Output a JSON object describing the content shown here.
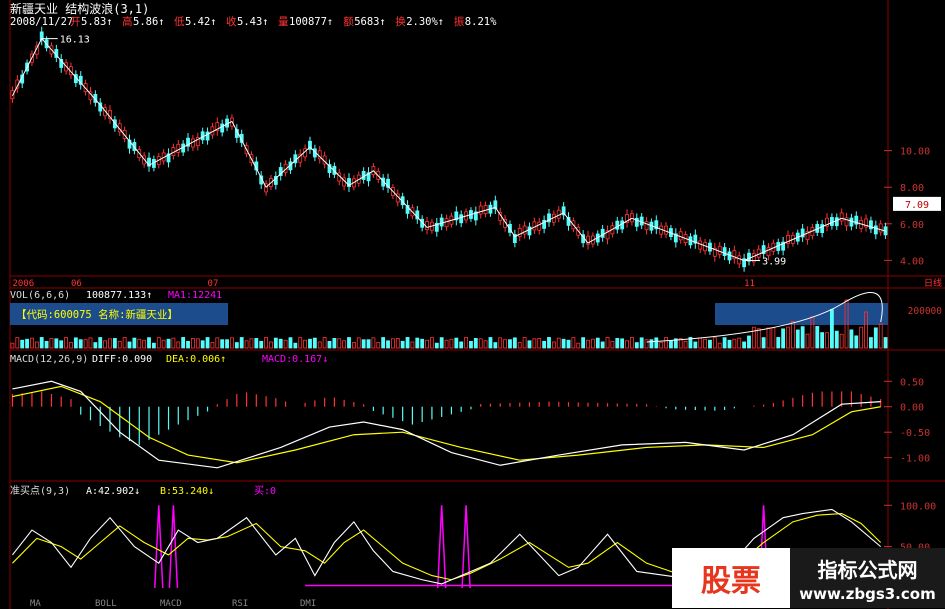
{
  "colors": {
    "up": "#ff3333",
    "down": "#54fcfc",
    "white": "#ffffff",
    "yellow": "#ffff00",
    "magenta": "#ff00ff",
    "grid": "#8b0000",
    "panel_label": "#dcdcdc",
    "axis": "#cc3333"
  },
  "header": {
    "title": "新疆天业  结构波浪(3,1)",
    "date": "2008/11/27",
    "items": [
      {
        "label": "开",
        "value": "5.83",
        "arrow": "↑"
      },
      {
        "label": "高",
        "value": "5.86",
        "arrow": "↑"
      },
      {
        "label": "低",
        "value": "5.42",
        "arrow": "↑"
      },
      {
        "label": "收",
        "value": "5.43",
        "arrow": "↑"
      },
      {
        "label": "量",
        "value": "100877",
        "arrow": "↑"
      },
      {
        "label": "额",
        "value": "5683",
        "arrow": "↑"
      },
      {
        "label": "换",
        "value": "2.30%",
        "arrow": "↑"
      },
      {
        "label": "振",
        "value": "8.21%",
        "arrow": ""
      }
    ]
  },
  "chart_data": [
    {
      "type": "candlestick",
      "panel": "price",
      "y_ticks": [
        "10.00",
        "8.00",
        "6.00",
        "4.00"
      ],
      "ylim": [
        3.2,
        16.6
      ],
      "current_price": "7.09",
      "annotations": [
        {
          "text": "16.13",
          "bar": 6,
          "value": 16.13
        },
        {
          "text": "3.99",
          "bar": 150,
          "value": 3.99
        }
      ],
      "x_labels": [
        {
          "text": "2006",
          "bar": 0
        },
        {
          "text": "06",
          "bar": 12
        },
        {
          "text": "07",
          "bar": 40
        },
        {
          "text": "11",
          "bar": 150
        }
      ],
      "period_label": "日线",
      "bar_count": 180,
      "wave": [
        [
          0,
          13.0
        ],
        [
          6,
          16.13
        ],
        [
          18,
          12.5
        ],
        [
          28,
          9.2
        ],
        [
          45,
          11.6
        ],
        [
          52,
          8.0
        ],
        [
          61,
          10.2
        ],
        [
          69,
          8.1
        ],
        [
          74,
          8.9
        ],
        [
          85,
          5.8
        ],
        [
          99,
          6.9
        ],
        [
          103,
          5.3
        ],
        [
          113,
          6.6
        ],
        [
          118,
          4.95
        ],
        [
          127,
          6.3
        ],
        [
          150,
          3.99
        ],
        [
          170,
          6.3
        ],
        [
          180,
          5.6
        ]
      ]
    },
    {
      "type": "bar",
      "panel": "volume",
      "label": "VOL(6,6,6)",
      "value_text": "100877.133",
      "ma_label": "MA1:12241",
      "info_box": "【代码:600075  名称:新疆天业】",
      "y_ticks": [
        "200000"
      ],
      "spikes": [
        [
          160,
          0.55
        ],
        [
          164,
          0.65
        ],
        [
          168,
          0.8
        ],
        [
          171,
          1.0
        ],
        [
          175,
          0.75
        ],
        [
          178,
          0.5
        ]
      ]
    },
    {
      "type": "line",
      "panel": "macd",
      "label": "MACD(12,26,9)",
      "diff": "DIFF:0.090",
      "dea": "DEA:0.006",
      "macd": "MACD:0.167",
      "y_ticks": [
        "0.50",
        "0.00",
        "-0.50",
        "-1.00"
      ],
      "ylim": [
        -1.4,
        0.8
      ],
      "diff_points": [
        [
          0,
          0.35
        ],
        [
          8,
          0.5
        ],
        [
          14,
          0.3
        ],
        [
          22,
          -0.5
        ],
        [
          30,
          -1.05
        ],
        [
          42,
          -1.2
        ],
        [
          55,
          -0.8
        ],
        [
          65,
          -0.4
        ],
        [
          72,
          -0.3
        ],
        [
          80,
          -0.45
        ],
        [
          90,
          -0.9
        ],
        [
          100,
          -1.15
        ],
        [
          112,
          -0.95
        ],
        [
          125,
          -0.75
        ],
        [
          138,
          -0.7
        ],
        [
          150,
          -0.85
        ],
        [
          160,
          -0.55
        ],
        [
          170,
          0.05
        ],
        [
          178,
          0.1
        ]
      ],
      "dea_points": [
        [
          0,
          0.2
        ],
        [
          10,
          0.4
        ],
        [
          18,
          0.1
        ],
        [
          28,
          -0.6
        ],
        [
          36,
          -0.95
        ],
        [
          46,
          -1.1
        ],
        [
          58,
          -0.85
        ],
        [
          70,
          -0.55
        ],
        [
          80,
          -0.5
        ],
        [
          92,
          -0.8
        ],
        [
          104,
          -1.05
        ],
        [
          116,
          -0.95
        ],
        [
          130,
          -0.8
        ],
        [
          142,
          -0.75
        ],
        [
          154,
          -0.8
        ],
        [
          164,
          -0.55
        ],
        [
          172,
          -0.1
        ],
        [
          178,
          0.0
        ]
      ],
      "hist_points": [
        [
          0,
          0.25
        ],
        [
          6,
          0.3
        ],
        [
          12,
          0.15
        ],
        [
          13,
          -0.1
        ],
        [
          22,
          -0.6
        ],
        [
          26,
          -0.75
        ],
        [
          34,
          -0.35
        ],
        [
          41,
          -0.05
        ],
        [
          42,
          0.05
        ],
        [
          47,
          0.3
        ],
        [
          55,
          0.15
        ],
        [
          58,
          0.0
        ],
        [
          59,
          0.05
        ],
        [
          65,
          0.2
        ],
        [
          72,
          0.05
        ],
        [
          73,
          -0.05
        ],
        [
          82,
          -0.35
        ],
        [
          94,
          -0.05
        ],
        [
          95,
          0.05
        ],
        [
          110,
          0.1
        ],
        [
          130,
          0.05
        ],
        [
          135,
          -0.05
        ],
        [
          145,
          -0.08
        ],
        [
          150,
          0.0
        ],
        [
          155,
          0.05
        ],
        [
          165,
          0.3
        ],
        [
          172,
          0.3
        ],
        [
          180,
          0.1
        ]
      ]
    },
    {
      "type": "line",
      "panel": "zhunmai",
      "label": "准买点(9,3)",
      "a_label": "A:42.902",
      "b_label": "B:53.240",
      "buy_label": "买:0",
      "y_ticks": [
        "100.00",
        "50.00"
      ],
      "ylim": [
        0,
        110
      ],
      "a_points": [
        [
          0,
          40
        ],
        [
          4,
          70
        ],
        [
          8,
          55
        ],
        [
          12,
          25
        ],
        [
          16,
          60
        ],
        [
          20,
          85
        ],
        [
          25,
          50
        ],
        [
          30,
          30
        ],
        [
          34,
          70
        ],
        [
          38,
          55
        ],
        [
          42,
          60
        ],
        [
          48,
          85
        ],
        [
          54,
          40
        ],
        [
          58,
          60
        ],
        [
          62,
          15
        ],
        [
          66,
          55
        ],
        [
          70,
          80
        ],
        [
          74,
          45
        ],
        [
          78,
          20
        ],
        [
          84,
          10
        ],
        [
          88,
          5
        ],
        [
          92,
          15
        ],
        [
          98,
          30
        ],
        [
          104,
          65
        ],
        [
          108,
          40
        ],
        [
          112,
          15
        ],
        [
          116,
          25
        ],
        [
          122,
          65
        ],
        [
          128,
          20
        ],
        [
          134,
          15
        ],
        [
          140,
          10
        ],
        [
          146,
          20
        ],
        [
          152,
          60
        ],
        [
          158,
          85
        ],
        [
          162,
          90
        ],
        [
          168,
          95
        ],
        [
          172,
          80
        ],
        [
          178,
          50
        ]
      ],
      "b_points": [
        [
          0,
          30
        ],
        [
          5,
          60
        ],
        [
          10,
          50
        ],
        [
          14,
          35
        ],
        [
          18,
          55
        ],
        [
          22,
          75
        ],
        [
          27,
          55
        ],
        [
          32,
          40
        ],
        [
          36,
          60
        ],
        [
          40,
          58
        ],
        [
          44,
          62
        ],
        [
          50,
          78
        ],
        [
          55,
          50
        ],
        [
          60,
          45
        ],
        [
          64,
          30
        ],
        [
          68,
          55
        ],
        [
          72,
          70
        ],
        [
          76,
          50
        ],
        [
          80,
          30
        ],
        [
          86,
          15
        ],
        [
          90,
          10
        ],
        [
          94,
          18
        ],
        [
          100,
          35
        ],
        [
          106,
          55
        ],
        [
          110,
          40
        ],
        [
          114,
          25
        ],
        [
          118,
          30
        ],
        [
          124,
          55
        ],
        [
          130,
          30
        ],
        [
          136,
          18
        ],
        [
          142,
          15
        ],
        [
          148,
          25
        ],
        [
          154,
          55
        ],
        [
          160,
          80
        ],
        [
          165,
          88
        ],
        [
          170,
          90
        ],
        [
          174,
          78
        ],
        [
          178,
          55
        ]
      ],
      "buy_spikes": [
        30,
        33,
        88,
        93,
        154
      ]
    }
  ],
  "footer_tabs": [
    "MA",
    "BOLL",
    "MACD",
    "RSI",
    "DMI"
  ],
  "watermark": {
    "left": "股票",
    "right_title": "指标公式网",
    "right_url": "www.zbgs3.com"
  }
}
